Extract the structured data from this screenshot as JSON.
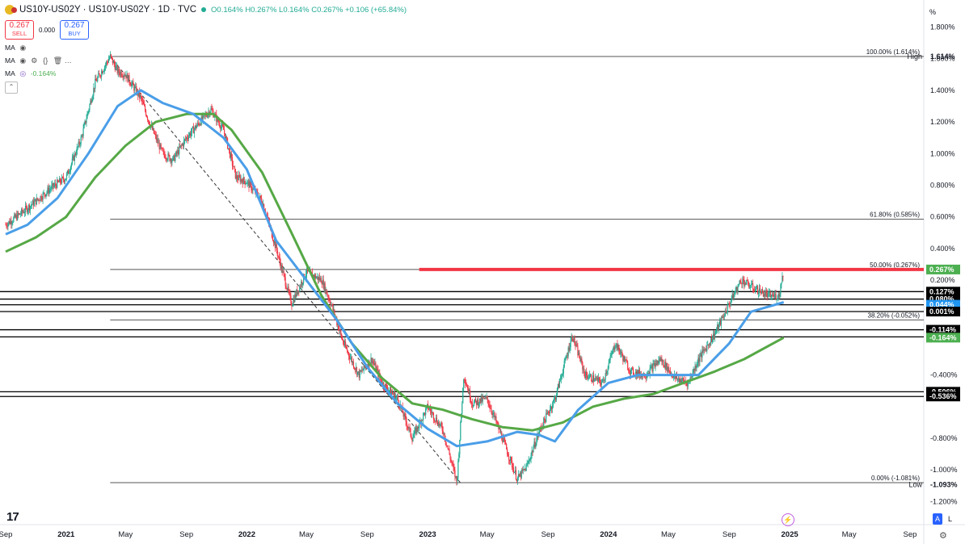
{
  "header": {
    "symbol": "US10Y-US02Y · US10Y-US02Y · 1D · TVC",
    "open": "O0.164%",
    "high": "H0.267%",
    "low": "L0.164%",
    "close": "C0.267%",
    "change": "+0.106 (+65.84%)"
  },
  "trade": {
    "sell_price": "0.267",
    "sell_label": "SELL",
    "spread": "0.000",
    "buy_price": "0.267",
    "buy_label": "BUY"
  },
  "indicators": [
    {
      "label": "MA",
      "value": ""
    },
    {
      "label": "MA",
      "value": ""
    },
    {
      "label": "MA",
      "value": "-0.164%"
    }
  ],
  "axis_unit": "%",
  "bottom": {
    "auto_label": "A",
    "log_label": "L"
  },
  "colors": {
    "up": "#22ab94",
    "down": "#f23645",
    "ma_fast": "#4a9ee8",
    "ma_slow": "#56a846",
    "resistance": "#f23645",
    "fib": "#131722"
  },
  "chart_data": {
    "type": "line",
    "ylim": [
      -1.3,
      1.9
    ],
    "y_ticks": [
      1.8,
      1.6,
      1.4,
      1.2,
      1.0,
      0.8,
      0.6,
      0.4,
      0.2,
      -0.4,
      -0.8,
      -1.0,
      -1.2
    ],
    "y_tick_labels": [
      "1.800%",
      "1.600%",
      "1.400%",
      "1.200%",
      "1.000%",
      "0.800%",
      "0.600%",
      "0.400%",
      "0.200%",
      "-0.400%",
      "-0.800%",
      "-1.000%",
      "-1.200%"
    ],
    "x_ticks": [
      {
        "label": "Sep",
        "date": "2020-09-01"
      },
      {
        "label": "2021",
        "date": "2021-01-01"
      },
      {
        "label": "May",
        "date": "2021-05-01"
      },
      {
        "label": "Sep",
        "date": "2021-09-01"
      },
      {
        "label": "2022",
        "date": "2022-01-01"
      },
      {
        "label": "May",
        "date": "2022-05-01"
      },
      {
        "label": "Sep",
        "date": "2022-09-01"
      },
      {
        "label": "2023",
        "date": "2023-01-01"
      },
      {
        "label": "May",
        "date": "2023-05-01"
      },
      {
        "label": "Sep",
        "date": "2023-09-01"
      },
      {
        "label": "2024",
        "date": "2024-01-01"
      },
      {
        "label": "May",
        "date": "2024-05-01"
      },
      {
        "label": "Sep",
        "date": "2024-09-01"
      },
      {
        "label": "2025",
        "date": "2025-01-01"
      },
      {
        "label": "May",
        "date": "2025-05-01"
      },
      {
        "label": "Sep",
        "date": "2025-09-01"
      }
    ],
    "price": [
      [
        "2020-09-01",
        0.55
      ],
      [
        "2020-10-01",
        0.62
      ],
      [
        "2020-11-01",
        0.7
      ],
      [
        "2020-12-01",
        0.78
      ],
      [
        "2021-01-01",
        0.85
      ],
      [
        "2021-02-01",
        1.1
      ],
      [
        "2021-03-01",
        1.45
      ],
      [
        "2021-03-31",
        1.614
      ],
      [
        "2021-04-15",
        1.52
      ],
      [
        "2021-05-01",
        1.5
      ],
      [
        "2021-06-01",
        1.35
      ],
      [
        "2021-06-20",
        1.18
      ],
      [
        "2021-07-15",
        1.0
      ],
      [
        "2021-08-05",
        0.96
      ],
      [
        "2021-09-01",
        1.1
      ],
      [
        "2021-10-20",
        1.28
      ],
      [
        "2021-11-15",
        1.15
      ],
      [
        "2021-12-10",
        0.85
      ],
      [
        "2022-01-01",
        0.82
      ],
      [
        "2022-02-01",
        0.7
      ],
      [
        "2022-03-01",
        0.4
      ],
      [
        "2022-04-01",
        0.05
      ],
      [
        "2022-05-01",
        0.25
      ],
      [
        "2022-06-01",
        0.2
      ],
      [
        "2022-06-20",
        0.05
      ],
      [
        "2022-07-15",
        -0.2
      ],
      [
        "2022-08-15",
        -0.4
      ],
      [
        "2022-09-10",
        -0.3
      ],
      [
        "2022-10-01",
        -0.45
      ],
      [
        "2022-11-01",
        -0.55
      ],
      [
        "2022-12-01",
        -0.8
      ],
      [
        "2023-01-01",
        -0.6
      ],
      [
        "2023-02-01",
        -0.75
      ],
      [
        "2023-03-01",
        -1.08
      ],
      [
        "2023-03-15",
        -0.4
      ],
      [
        "2023-04-01",
        -0.58
      ],
      [
        "2023-05-01",
        -0.55
      ],
      [
        "2023-06-01",
        -0.8
      ],
      [
        "2023-07-01",
        -1.06
      ],
      [
        "2023-07-20",
        -0.98
      ],
      [
        "2023-08-15",
        -0.75
      ],
      [
        "2023-09-15",
        -0.55
      ],
      [
        "2023-10-20",
        -0.15
      ],
      [
        "2023-11-15",
        -0.4
      ],
      [
        "2023-12-20",
        -0.45
      ],
      [
        "2024-01-15",
        -0.2
      ],
      [
        "2024-02-15",
        -0.38
      ],
      [
        "2024-03-15",
        -0.4
      ],
      [
        "2024-04-15",
        -0.3
      ],
      [
        "2024-05-15",
        -0.42
      ],
      [
        "2024-06-10",
        -0.45
      ],
      [
        "2024-07-01",
        -0.3
      ],
      [
        "2024-08-01",
        -0.15
      ],
      [
        "2024-09-01",
        0.05
      ],
      [
        "2024-09-25",
        0.2
      ],
      [
        "2024-10-20",
        0.15
      ],
      [
        "2024-11-20",
        0.1
      ],
      [
        "2024-12-10",
        0.1
      ],
      [
        "2024-12-20",
        0.267
      ]
    ],
    "ma_fast": [
      [
        "2020-09-01",
        0.49
      ],
      [
        "2020-10-15",
        0.55
      ],
      [
        "2020-12-15",
        0.72
      ],
      [
        "2021-02-15",
        1.0
      ],
      [
        "2021-04-15",
        1.3
      ],
      [
        "2021-06-01",
        1.4
      ],
      [
        "2021-07-15",
        1.32
      ],
      [
        "2021-09-15",
        1.25
      ],
      [
        "2021-11-15",
        1.1
      ],
      [
        "2022-01-01",
        0.9
      ],
      [
        "2022-03-01",
        0.45
      ],
      [
        "2022-05-01",
        0.2
      ],
      [
        "2022-07-01",
        -0.05
      ],
      [
        "2022-09-01",
        -0.35
      ],
      [
        "2022-11-01",
        -0.58
      ],
      [
        "2023-01-01",
        -0.74
      ],
      [
        "2023-03-01",
        -0.85
      ],
      [
        "2023-05-01",
        -0.82
      ],
      [
        "2023-07-01",
        -0.76
      ],
      [
        "2023-08-15",
        -0.78
      ],
      [
        "2023-09-15",
        -0.82
      ],
      [
        "2023-11-01",
        -0.62
      ],
      [
        "2024-01-01",
        -0.45
      ],
      [
        "2024-03-01",
        -0.4
      ],
      [
        "2024-05-01",
        -0.4
      ],
      [
        "2024-07-01",
        -0.4
      ],
      [
        "2024-09-01",
        -0.2
      ],
      [
        "2024-10-15",
        0.0
      ],
      [
        "2024-12-20",
        0.06
      ]
    ],
    "ma_slow": [
      [
        "2020-09-01",
        0.38
      ],
      [
        "2020-11-01",
        0.47
      ],
      [
        "2021-01-01",
        0.6
      ],
      [
        "2021-03-01",
        0.85
      ],
      [
        "2021-05-01",
        1.05
      ],
      [
        "2021-07-01",
        1.2
      ],
      [
        "2021-09-01",
        1.25
      ],
      [
        "2021-10-25",
        1.25
      ],
      [
        "2021-12-01",
        1.15
      ],
      [
        "2022-02-01",
        0.88
      ],
      [
        "2022-04-01",
        0.5
      ],
      [
        "2022-06-01",
        0.1
      ],
      [
        "2022-08-01",
        -0.2
      ],
      [
        "2022-10-01",
        -0.42
      ],
      [
        "2022-12-01",
        -0.58
      ],
      [
        "2023-02-01",
        -0.62
      ],
      [
        "2023-04-01",
        -0.68
      ],
      [
        "2023-06-01",
        -0.73
      ],
      [
        "2023-08-01",
        -0.75
      ],
      [
        "2023-10-01",
        -0.7
      ],
      [
        "2023-12-01",
        -0.6
      ],
      [
        "2024-02-01",
        -0.55
      ],
      [
        "2024-04-01",
        -0.52
      ],
      [
        "2024-06-01",
        -0.45
      ],
      [
        "2024-08-01",
        -0.38
      ],
      [
        "2024-10-01",
        -0.3
      ],
      [
        "2024-12-20",
        -0.164
      ]
    ],
    "fib_levels": [
      {
        "value": 1.614,
        "label": "100.00% (1.614%)"
      },
      {
        "value": 0.585,
        "label": "61.80% (0.585%)"
      },
      {
        "value": 0.267,
        "label": "50.00% (0.267%)"
      },
      {
        "value": -0.052,
        "label": "38.20% (-0.052%)"
      },
      {
        "value": -1.081,
        "label": "0.00% (-1.081%)"
      }
    ],
    "fib_start": "2021-03-31",
    "horizontal_levels": [
      0.127,
      0.08,
      0.044,
      0.001,
      -0.114,
      -0.159,
      -0.506,
      -0.536
    ],
    "resistance": {
      "value": 0.267,
      "start": "2022-12-15"
    },
    "trendline": [
      [
        "2021-03-31",
        1.614
      ],
      [
        "2023-03-08",
        -1.081
      ]
    ],
    "price_tags": [
      {
        "value": 1.614,
        "label": "1.614%",
        "tag": "High",
        "style": "plain"
      },
      {
        "value": 0.267,
        "label": "0.267%",
        "style": "green"
      },
      {
        "value": 0.127,
        "label": "0.127%",
        "style": "dark"
      },
      {
        "value": 0.08,
        "label": "0.080%",
        "style": "dark"
      },
      {
        "value": 0.044,
        "label": "0.044%",
        "style": "blue"
      },
      {
        "value": 0.001,
        "label": "0.001%",
        "style": "dark"
      },
      {
        "value": -0.114,
        "label": "-0.114%",
        "style": "dark"
      },
      {
        "value": -0.159,
        "label": "-0.159%",
        "style": "dark"
      },
      {
        "value": -0.164,
        "label": "-0.164%",
        "style": "green"
      },
      {
        "value": -0.506,
        "label": "-0.506%",
        "style": "dark"
      },
      {
        "value": -0.536,
        "label": "-0.536%",
        "style": "dark"
      },
      {
        "value": -1.093,
        "label": "-1.093%",
        "tag": "Low",
        "style": "plain"
      }
    ]
  }
}
